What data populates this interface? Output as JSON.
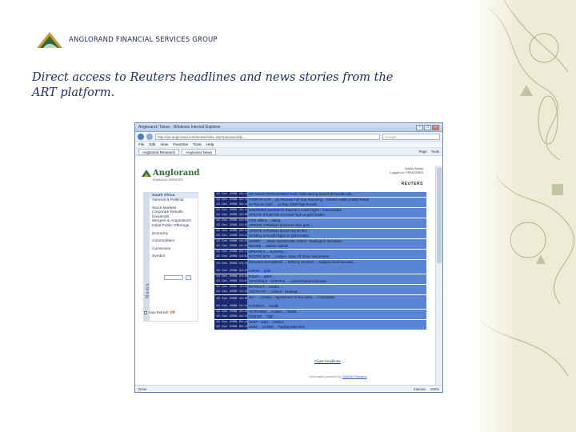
{
  "company": "ANGLORAND FINANCIAL SERVICES GROUP",
  "headline": "Direct access to Reuters headlines and news stories from the ART platform.",
  "colors": {
    "accent": "#1f2d63",
    "news_time_bg": "#1a2a6e",
    "news_headline_bg": "#5a85d4",
    "brand_green": "#2c6e3a"
  },
  "browser": {
    "title": "Anglorand / News - Windows Internet Explorer",
    "address": "http://art.anglorand.com/news/index.asp?passwordId=...",
    "search_placeholder": "Google",
    "menu": [
      "File",
      "Edit",
      "View",
      "Favorites",
      "Tools",
      "Help"
    ],
    "tabs": [
      "Anglorand Research",
      "Anglorand News"
    ],
    "tab_tools": [
      "Page",
      "Tools"
    ]
  },
  "app": {
    "brand": "Anglorand",
    "brand_sub": "FINANCIAL SERVICES",
    "user_info": [
      "Bobby Bobby",
      "Logged on: PRIVATEBIA"
    ],
    "reuters": "REUTERS",
    "news_tab": "News",
    "nav": [
      "South Africa",
      "General & Political",
      "Stock Markets",
      "Corporate Results",
      "Dividends",
      "Mergers & Acquisitions",
      "Initial Public Offerings",
      "Economy",
      "Commodities",
      "Currencies",
      "Symbol"
    ],
    "auto_refresh": "Auto Refresh",
    "auto_refresh_state": "Off",
    "close_link": "Close headlines",
    "powered_by": "Information powered by",
    "powered_link": "ClickNet Solutions"
  },
  "news": [
    {
      "time": "13 Oct 2009 16:15",
      "headline": "GE-GOLD-AFRICAN BDC/ Gold Fields Mining Sees Full Results Adv..."
    },
    {
      "time": "13 Oct 2009 16:16",
      "headline": "PAMPOP-CAP ... plc Renews Full Year Reporting... Growth results (Adds) Result"
    },
    {
      "time": "13 Oct 2009 16:16",
      "headline": "NI Phicore Gold ... Co Rep 2009 Final Results"
    },
    {
      "time": "13 Oct 2009 15:41",
      "headline": "EMERGING MARKETS-Rand at 1-month highs - Commodities"
    },
    {
      "time": "13 Oct 2009 15:00",
      "headline": "UPDATE 3-Gold hits 12-month high as gold market ..."
    },
    {
      "time": "13 Oct 2009 14:56",
      "headline": "Fitch affirms ... rating"
    },
    {
      "time": "13 Oct 2009 14:55",
      "headline": "UPDATE 1-Platinum producers face gold ..."
    },
    {
      "time": "13 Oct 2009 14:43",
      "headline": "UPDATE 1-Platinum stocks rise on firm ..."
    },
    {
      "time": "13 Oct 2009 14:41",
      "headline": "Grinding 10-month highs on gold market ..."
    },
    {
      "time": "13 Oct 2009 14:37",
      "headline": "ZEDER - ... Zeder Investments Limited - Dealings in Securities ..."
    },
    {
      "time": "13 Oct 2009 14:33",
      "headline": "MCORE ... Market outlook ..."
    },
    {
      "time": "13 Oct 2009 14:21",
      "headline": "UPDATE 2-... economy ..."
    },
    {
      "time": "13 Oct 2009 13:53",
      "headline": "INCORE BOR ... Limited - Issue Of Share Instruments"
    },
    {
      "time": "13 Oct 2009 13:32",
      "headline": "Research and Markets: ... Delivery Services ... Analysis and Forecasts ..."
    },
    {
      "time": "13 Oct 2009 13:26",
      "headline": "Anthea ... gold ..."
    },
    {
      "time": "13 Oct 2009 13:20",
      "headline": "Eskom ... plans ..."
    },
    {
      "time": "13 Oct 2009 13:07",
      "headline": "CENTGOLD - CENTRAL ... Central Rand Gold Mine ..."
    },
    {
      "time": "13 Oct 2009 12:56",
      "headline": "EXTRACT ... results ..."
    },
    {
      "time": "13 Oct 2009 12:36",
      "headline": "JSE/STATE ... Limited - Dealings ..."
    },
    {
      "time": "13 Oct 2009 12:08",
      "headline": "NIA - ... Limited - Appointment of Executive ... Consultants"
    },
    {
      "time": "13 Oct 2009 11:44",
      "headline": "S AFRICA ... results"
    },
    {
      "time": "13 Oct 2009 10:40",
      "headline": "ACTOVIEW ... Actions ... results ..."
    },
    {
      "time": "13 Oct 2009 10:23",
      "headline": "Gold hits ... high ..."
    },
    {
      "time": "13 Oct 2009 09:48",
      "headline": "SCBT - Gold ... Limited ..."
    },
    {
      "time": "13 Oct 2009 09:15",
      "headline": "SEDZ ... Limited ... Trading statement"
    }
  ],
  "status": {
    "done": "Done",
    "zone": "Internet",
    "zoom": "100%"
  }
}
